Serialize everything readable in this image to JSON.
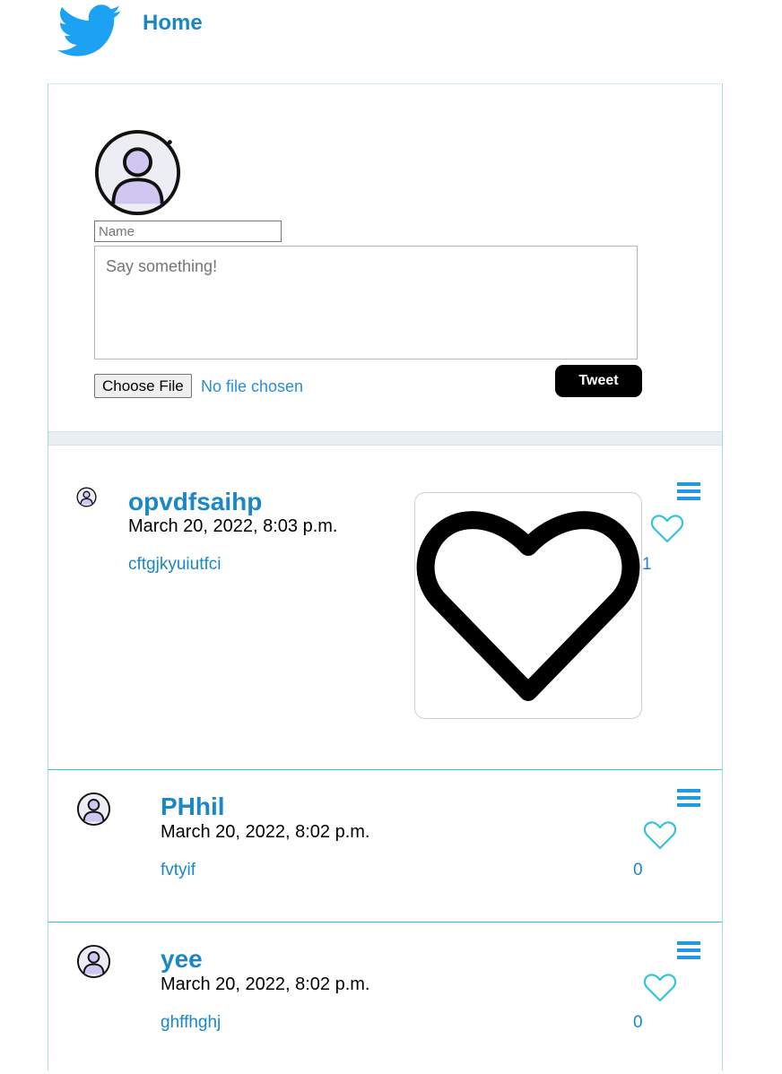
{
  "header": {
    "title": "Home",
    "logo_icon": "twitter-bird-icon"
  },
  "composer": {
    "avatar_icon": "default-user-avatar-icon",
    "name_placeholder": "Name",
    "message_placeholder": "Say something!",
    "file_button_label": "Choose File",
    "file_status": "No file chosen",
    "submit_label": "Tweet"
  },
  "posts": [
    {
      "user": "opvdfsaihp",
      "time": "March 20, 2022, 8:03 p.m.",
      "text": "cftgjkyuiutfci",
      "likes": "1",
      "has_image": true,
      "image_icon": "heart-outline-image"
    },
    {
      "user": "PHhil",
      "time": "March 20, 2022, 8:02 p.m.",
      "text": "fvtyif",
      "likes": "0",
      "has_image": false
    },
    {
      "user": "yee",
      "time": "March 20, 2022, 8:02 p.m.",
      "text": "ghffhghj",
      "likes": "0",
      "has_image": false
    }
  ],
  "colors": {
    "brand_blue": "#1b87c6",
    "twitter_blue": "#1da1f2",
    "like_outline": "#35c3d9",
    "border": "#35c3d9"
  }
}
